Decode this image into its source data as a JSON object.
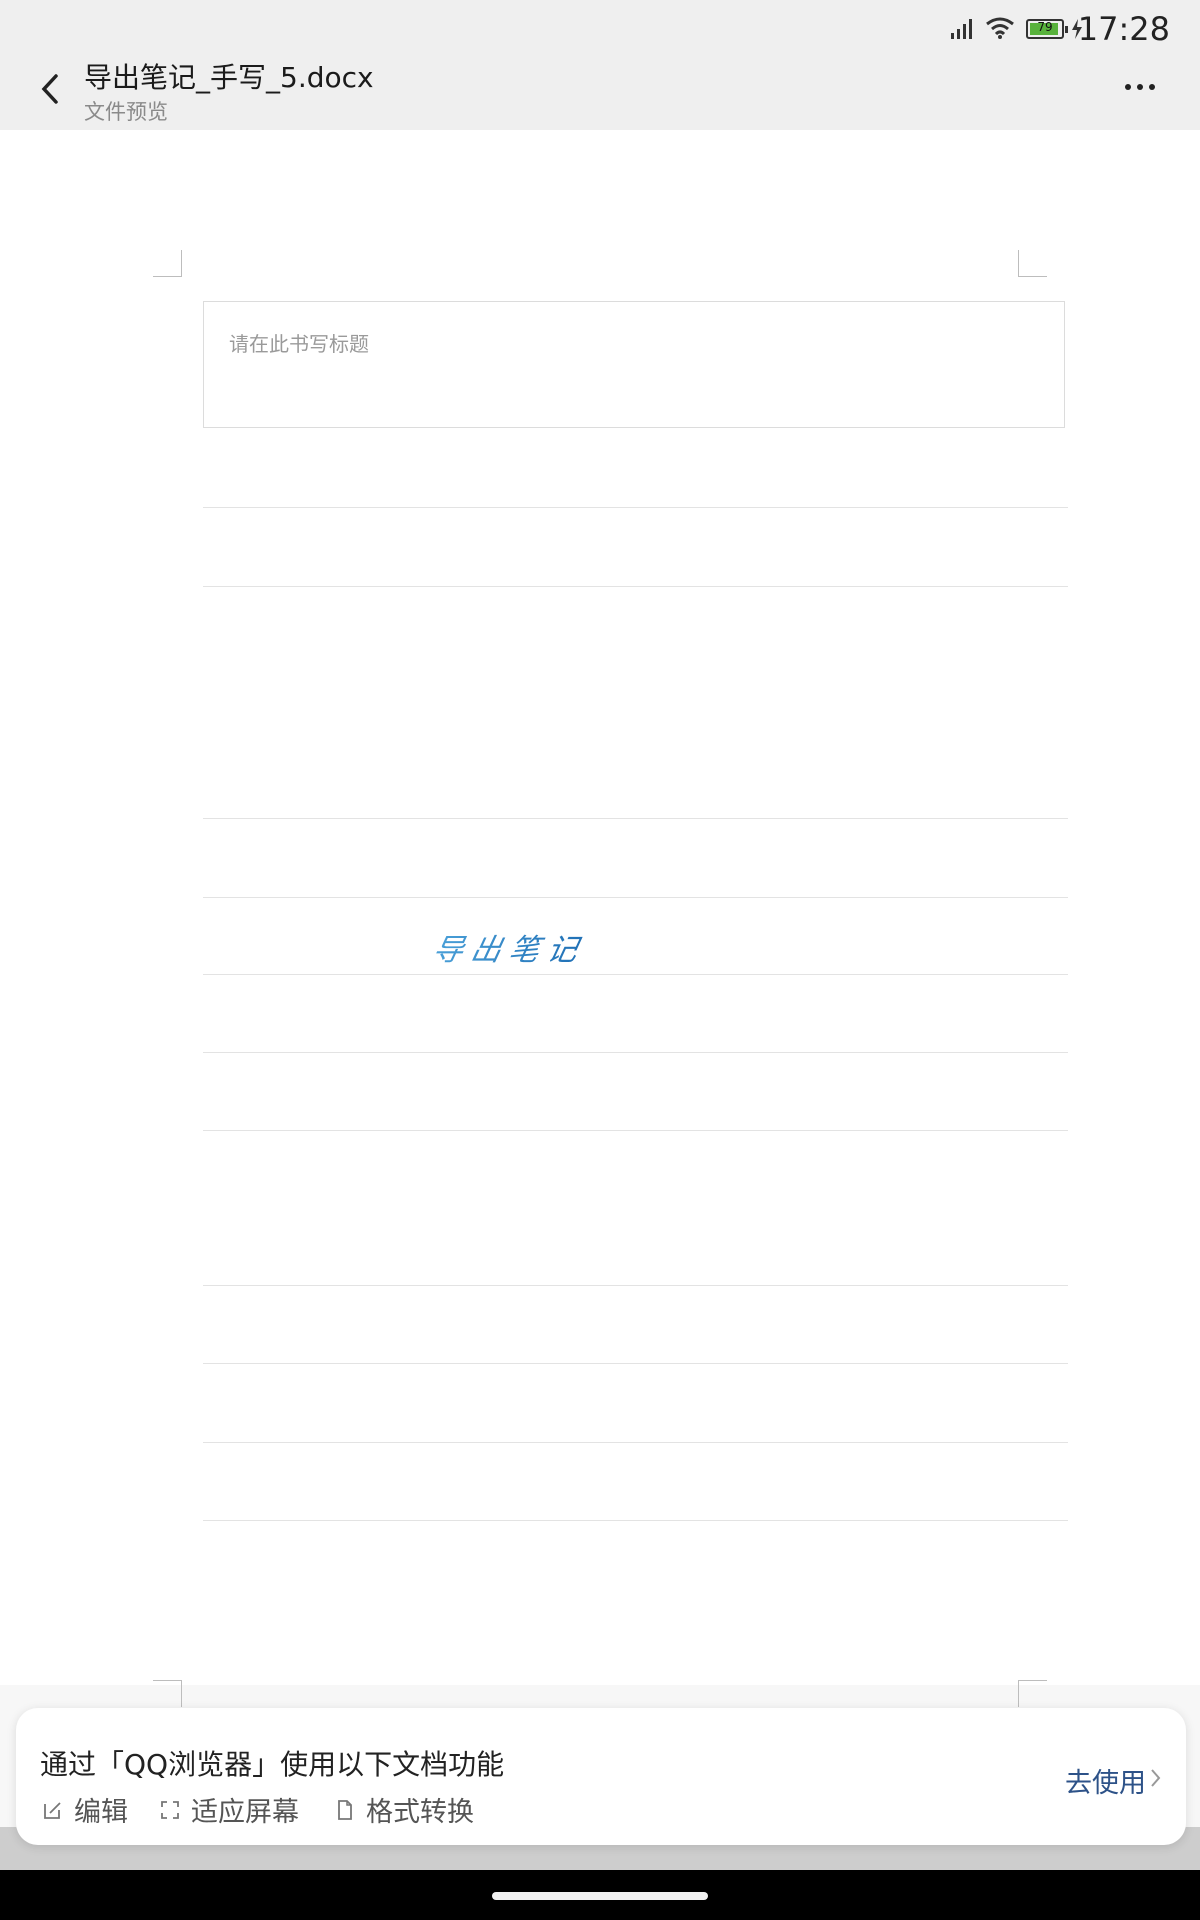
{
  "status_bar": {
    "time": "17:28",
    "battery": "79",
    "icons": [
      "signal-icon",
      "wifi-icon",
      "battery-icon",
      "charging-icon"
    ]
  },
  "header": {
    "title": "导出笔记_手写_5.docx",
    "subtitle": "文件预览",
    "icons": [
      "back-arrow-icon",
      "more-icon"
    ]
  },
  "document": {
    "title_placeholder": "请在此书写标题",
    "handwritten_text": "导出笔记",
    "handwriting_color": "#2f86c6"
  },
  "promo": {
    "text": "通过「QQ浏览器」使用以下文档功能",
    "features": [
      {
        "label": "编辑",
        "icon": "edit-icon"
      },
      {
        "label": "适应屏幕",
        "icon": "fit-screen-icon"
      },
      {
        "label": "格式转换",
        "icon": "document-icon"
      }
    ],
    "cta": "去使用",
    "cta_color": "#2d5288"
  }
}
